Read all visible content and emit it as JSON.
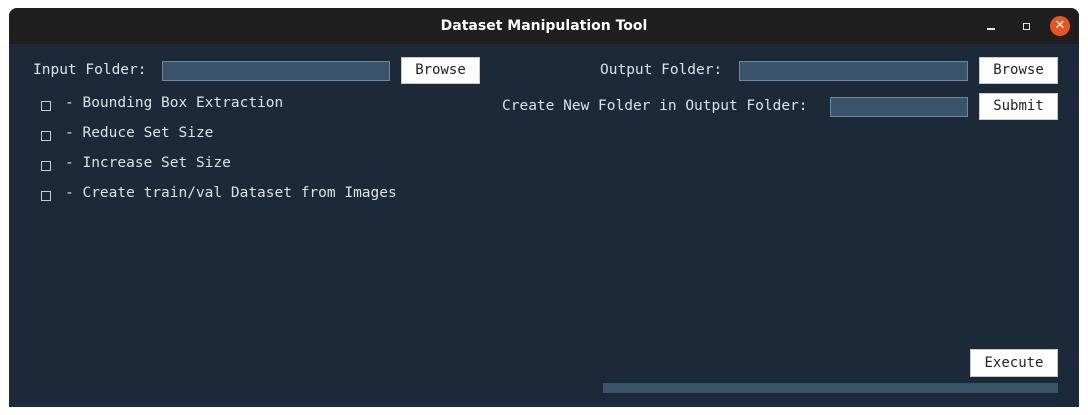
{
  "window": {
    "title": "Dataset Manipulation Tool",
    "controls": [
      "minimize-icon",
      "maximize-icon",
      "close-icon"
    ],
    "close_symbol": "✕"
  },
  "input": {
    "label": "Input Folder:",
    "value": "",
    "browse_label": "Browse"
  },
  "output": {
    "label": "Output Folder:",
    "value": "",
    "browse_label": "Browse"
  },
  "new_folder": {
    "label": "Create New Folder in Output Folder:",
    "value": "",
    "submit_label": "Submit"
  },
  "options": [
    {
      "label": "- Bounding Box Extraction",
      "checked": false
    },
    {
      "label": "- Reduce Set Size",
      "checked": false
    },
    {
      "label": "- Increase Set Size",
      "checked": false
    },
    {
      "label": "- Create train/val Dataset from Images",
      "checked": false
    }
  ],
  "execute_label": "Execute",
  "progress": 0,
  "colors": {
    "background": "#1b2938",
    "field": "#3a556b",
    "close_button": "#e95420"
  }
}
